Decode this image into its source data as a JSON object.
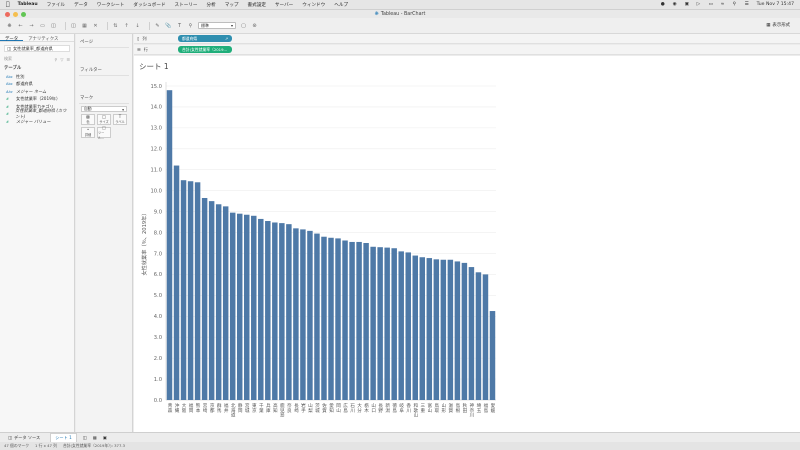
{
  "menubar": {
    "app_name": "Tableau",
    "items": [
      "ファイル",
      "データ",
      "ワークシート",
      "ダッシュボード",
      "ストーリー",
      "分析",
      "マップ",
      "書式設定",
      "サーバー",
      "ウィンドウ",
      "ヘルプ"
    ],
    "clock": "Tue Nov 7  15:47"
  },
  "window": {
    "title": "Tableau - BarChart"
  },
  "toolbar": {
    "fit_value": "標準",
    "show_me_label": "表示形式"
  },
  "data_pane": {
    "tabs": [
      "データ",
      "アナリティクス"
    ],
    "source": "女性就業率_都道府県",
    "search_placeholder": "検索",
    "table_heading": "テーブル",
    "fields": [
      {
        "icon": "Abc",
        "label": "性別",
        "kind": "dim"
      },
      {
        "icon": "Abc",
        "label": "都道府県",
        "kind": "dim"
      },
      {
        "icon": "Abc",
        "label": "メジャー ネーム",
        "kind": "dim",
        "italic": true
      },
      {
        "icon": "#",
        "label": "女性就業率（2019年）",
        "kind": "mea"
      },
      {
        "icon": "#",
        "label": "女性就業率カテゴリ",
        "kind": "mea"
      },
      {
        "icon": "#",
        "label": "女性就業率_都道府県 (カウント)",
        "kind": "mea",
        "italic": true
      },
      {
        "icon": "#",
        "label": "メジャー バリュー",
        "kind": "mea",
        "italic": true
      }
    ]
  },
  "cards": {
    "pages": "ページ",
    "filters": "フィルター",
    "marks": "マーク",
    "mark_type": "自動",
    "mark_buttons": [
      "色",
      "サイズ",
      "ラベル",
      "詳細",
      "ツール..."
    ]
  },
  "shelves": {
    "columns_label": "列",
    "rows_label": "行",
    "columns_pill": "都道府県",
    "rows_pill": "合計(女性就業率（2019..."
  },
  "sheet": {
    "title": "シート 1"
  },
  "chart_data": {
    "type": "bar",
    "ylabel": "女性就業率（％、2019年）",
    "ylim": [
      0,
      15
    ],
    "y_ticks": [
      "0.0",
      "1.0",
      "2.0",
      "3.0",
      "4.0",
      "5.0",
      "6.0",
      "7.0",
      "8.0",
      "9.0",
      "10.0",
      "11.0",
      "12.0",
      "13.0",
      "14.0",
      "15.0"
    ],
    "categories": [
      "青森",
      "沖縄",
      "大阪",
      "福岡",
      "熊本",
      "宮崎",
      "京都",
      "群馬",
      "福井",
      "北海道",
      "静岡",
      "宮城",
      "東京",
      "千葉",
      "兵庫",
      "高知",
      "鹿児島",
      "奈良",
      "長崎",
      "岩手",
      "山梨",
      "茨城",
      "佐賀",
      "愛知",
      "岡山",
      "広島",
      "石川",
      "大分",
      "栃木",
      "山口",
      "長野",
      "新潟",
      "徳島",
      "岐阜",
      "香川",
      "和歌山",
      "三重",
      "富山",
      "鳥取",
      "山形",
      "滋賀",
      "島根",
      "秋田",
      "神奈川",
      "埼玉",
      "福島",
      "愛媛"
    ],
    "values": [
      14.8,
      11.2,
      10.5,
      10.45,
      10.4,
      9.65,
      9.5,
      9.35,
      9.25,
      8.95,
      8.9,
      8.85,
      8.8,
      8.65,
      8.55,
      8.48,
      8.45,
      8.4,
      8.2,
      8.15,
      8.08,
      7.95,
      7.8,
      7.75,
      7.72,
      7.62,
      7.55,
      7.55,
      7.5,
      7.32,
      7.3,
      7.28,
      7.25,
      7.1,
      7.05,
      6.9,
      6.82,
      6.78,
      6.72,
      6.7,
      6.7,
      6.62,
      6.55,
      6.35,
      6.1,
      6.0,
      4.25
    ],
    "grid": true
  },
  "bottom": {
    "datasource_tab": "データ ソース",
    "sheet_tab": "シート 1",
    "status_marks": "47 個のマーク",
    "status_dims": "1 行 x 47 列",
    "status_sum": "合計(女性就業率（2019年）): 377.3"
  }
}
